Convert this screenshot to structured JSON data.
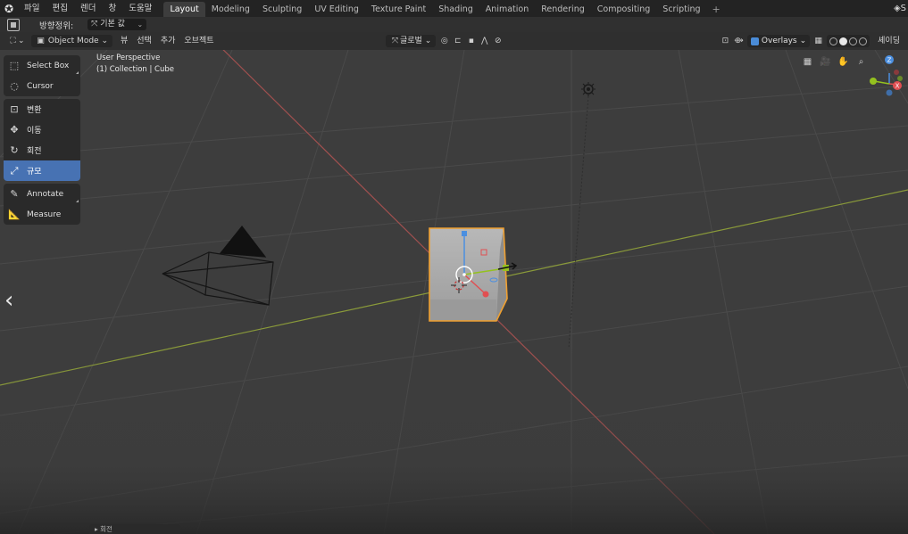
{
  "topbar": {
    "logo_icon": "blender-logo-icon",
    "menus": [
      "파일",
      "편집",
      "렌더",
      "창",
      "도움말"
    ],
    "tabs": [
      {
        "label": "Layout",
        "active": true
      },
      {
        "label": "Modeling"
      },
      {
        "label": "Sculpting"
      },
      {
        "label": "UV Editing"
      },
      {
        "label": "Texture Paint"
      },
      {
        "label": "Shading"
      },
      {
        "label": "Animation"
      },
      {
        "label": "Rendering"
      },
      {
        "label": "Compositing"
      },
      {
        "label": "Scripting"
      }
    ],
    "add_tab": "+",
    "scene_label": "S"
  },
  "toolsettings": {
    "orientation_label": "방향정위:",
    "orientation_value": "기본 값"
  },
  "vheader": {
    "mode": "Object Mode",
    "menus": [
      "뷰",
      "선택",
      "추가",
      "오브젝트"
    ],
    "transform_orientation": "글로벌",
    "overlays_label": "Overlays",
    "shading_label": "셰이딩"
  },
  "viewport": {
    "view_name": "User Perspective",
    "collection_label": "(1) Collection | Cube",
    "colors": {
      "background": "#3d3d3d",
      "x_axis": "#a0504f",
      "y_axis": "#8a9a3a",
      "selection": "#f0a030"
    }
  },
  "toolbar": {
    "groups": [
      [
        {
          "label": "Select Box",
          "icon": "select-box-icon"
        },
        {
          "label": "Cursor",
          "icon": "cursor-icon"
        }
      ],
      [
        {
          "label": "변환",
          "icon": "transform-icon"
        },
        {
          "label": "이동",
          "icon": "move-icon"
        },
        {
          "label": "회전",
          "icon": "rotate-icon"
        },
        {
          "label": "규모",
          "icon": "scale-icon",
          "active": true
        }
      ],
      [
        {
          "label": "Annotate",
          "icon": "annotate-icon"
        },
        {
          "label": "Measure",
          "icon": "measure-icon"
        }
      ]
    ]
  },
  "gizmo": {
    "x": "X",
    "y": "Y",
    "z": "Z"
  },
  "last_operator": {
    "label": "회전"
  }
}
